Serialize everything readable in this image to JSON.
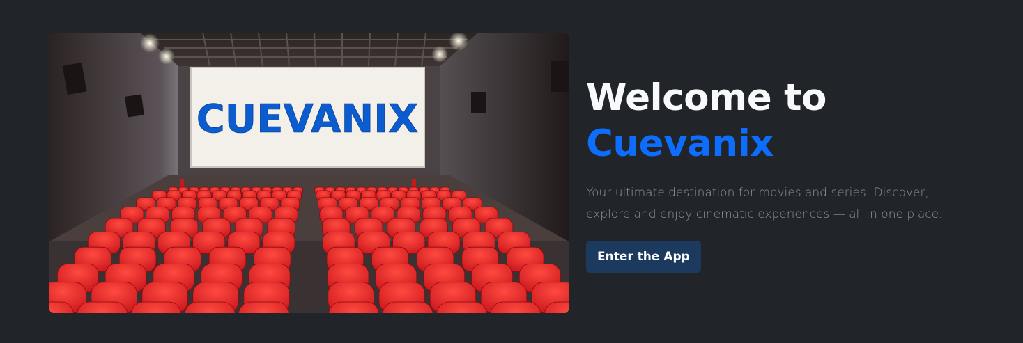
{
  "hero": {
    "image": {
      "screen_text": "CUEVANIX",
      "alt": "cinema-hall-image"
    },
    "title_line1": "Welcome to",
    "title_brand": "Cuevanix",
    "tagline": "Your ultimate destination for movies and series. Discover, explore and enjoy cinematic experiences — all in one place.",
    "cta_label": "Enter the App"
  },
  "colors": {
    "background": "#212529",
    "brand": "#0d6efd",
    "title": "#f8f9fa",
    "tagline": "#8c949c",
    "cta_background": "#1c3a5e",
    "seat": "#e32626",
    "screen_text": "#0b5ccf"
  }
}
